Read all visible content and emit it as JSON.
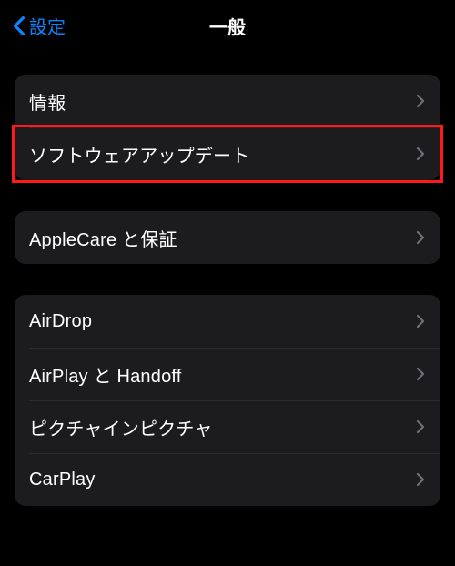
{
  "nav": {
    "back_label": "設定",
    "title": "一般"
  },
  "groups": [
    {
      "rows": [
        {
          "label": "情報"
        },
        {
          "label": "ソフトウェアアップデート",
          "highlighted": true
        }
      ]
    },
    {
      "rows": [
        {
          "label": "AppleCare と保証"
        }
      ]
    },
    {
      "rows": [
        {
          "label": "AirDrop"
        },
        {
          "label": "AirPlay と Handoff"
        },
        {
          "label": "ピクチャインピクチャ"
        },
        {
          "label": "CarPlay"
        }
      ]
    }
  ]
}
